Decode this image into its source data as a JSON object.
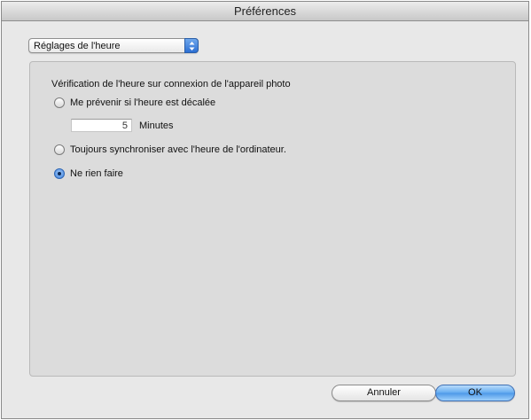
{
  "window": {
    "title": "Préférences"
  },
  "category_select": {
    "value": "Réglages de l'heure",
    "icon": "stepper-arrows-icon"
  },
  "time_check": {
    "heading": "Vérification de l'heure sur connexion de l'appareil photo",
    "options": [
      {
        "label": "Me prévenir si l'heure est décalée",
        "checked": false
      },
      {
        "label": "Toujours synchroniser avec l'heure de l'ordinateur.",
        "checked": false
      },
      {
        "label": "Ne rien faire",
        "checked": true
      }
    ],
    "minutes_value": "5",
    "minutes_label": "Minutes"
  },
  "buttons": {
    "cancel": "Annuler",
    "ok": "OK"
  },
  "colors": {
    "accent": "#4c98e8",
    "panel": "#dcdcdc",
    "window": "#e8e8e8"
  }
}
